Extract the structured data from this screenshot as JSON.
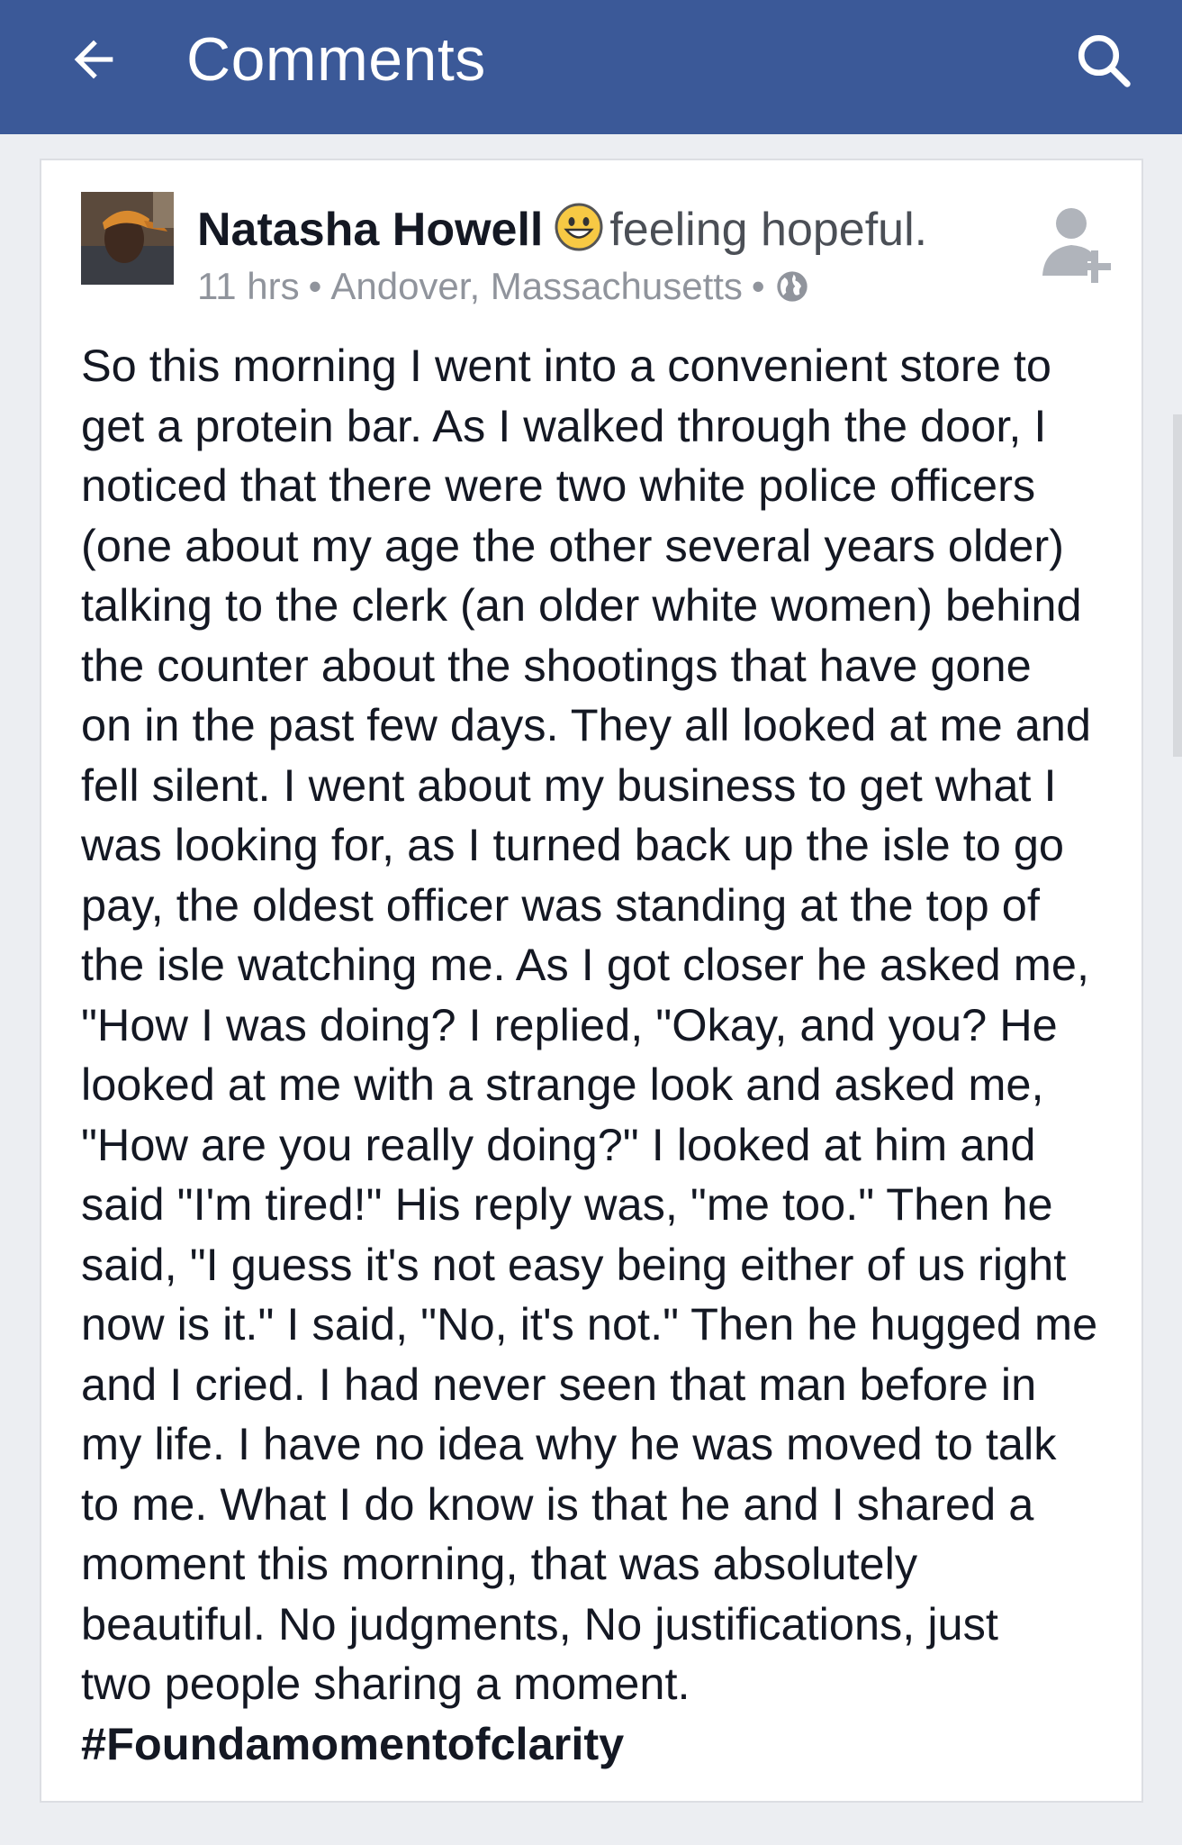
{
  "appbar": {
    "title": "Comments",
    "back_icon": "arrow-left-icon",
    "search_icon": "search-icon",
    "color": "#3b5998"
  },
  "post": {
    "author": "Natasha Howell",
    "feeling_emoji": "smiley-face-icon",
    "feeling": "feeling hopeful.",
    "time": "11 hrs",
    "location": "Andover, Massachusetts",
    "separator": "•",
    "privacy_icon": "globe-icon",
    "add_friend_icon": "add-friend-icon",
    "body_lines": [
      "So this morning I went into a convenient store to",
      "get a protein bar. As I walked through the door, I",
      "noticed that there were two white police officers",
      "(one about my age the other several years older)",
      "talking to the clerk (an older white women) behind",
      "the counter about the shootings that have gone",
      "on in the past few days. They all looked at me and",
      "fell silent. I went about my business to get what I",
      "was looking for, as I turned back up the isle to go",
      "pay, the oldest officer was standing at the top of",
      "the isle watching me. As I got closer he asked me,",
      "\"How I was doing? I replied, \"Okay, and you? He",
      "looked at me  with a strange look and asked me,",
      "\"How are you really doing?\" I looked at him and",
      "said \"I'm tired!\" His reply was, \"me too.\" Then he",
      "said, \"I guess it's not easy being either of us right",
      "now is it.\" I said, \"No, it's not.\" Then he hugged me",
      "and I cried.  I had never seen that man before in",
      "my life. I have no idea why he was moved to talk",
      "to me. What I do know is that he and I shared a",
      "moment this morning, that was absolutely",
      "beautiful. No judgments, No justifications, just",
      "two people sharing a moment."
    ],
    "hashtag": "#Foundamomentofclarity"
  }
}
